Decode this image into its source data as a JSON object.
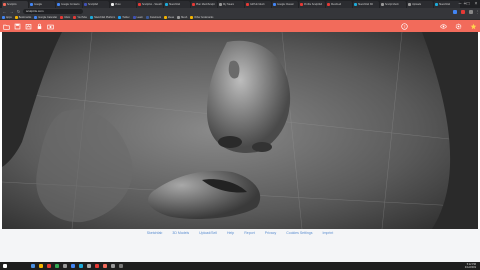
{
  "tabs": [
    {
      "label": "Sculptris",
      "active": true,
      "color": "#f26b5b"
    },
    {
      "label": "Google",
      "active": false,
      "color": "#4285f4"
    },
    {
      "label": "Google Contacts",
      "active": false,
      "color": "#4285f4"
    },
    {
      "label": "Sculptfab",
      "active": false,
      "color": "#3f51b5"
    },
    {
      "label": "Pluto",
      "active": false,
      "color": "#eeeeee"
    },
    {
      "label": "SculptGL - Sketchfab",
      "active": false,
      "color": "#e53935"
    },
    {
      "label": "Sketchfab",
      "active": false,
      "color": "#1caad9"
    },
    {
      "label": "Plan MeshSculpt",
      "active": false,
      "color": "#e53935"
    },
    {
      "label": "My Steam",
      "active": false,
      "color": "#999999"
    },
    {
      "label": "GitHub Mesh",
      "active": false,
      "color": "#e53935"
    },
    {
      "label": "Google Classic",
      "active": false,
      "color": "#4285f4"
    },
    {
      "label": "Profile Sculptfab",
      "active": false,
      "color": "#e53935"
    },
    {
      "label": "MeshLab",
      "active": false,
      "color": "#e53935"
    },
    {
      "label": "Sketchfab 3D",
      "active": false,
      "color": "#1caad9"
    },
    {
      "label": "Sculpt Mesh",
      "active": false,
      "color": "#999999"
    },
    {
      "label": "Uploads",
      "active": false,
      "color": "#999999"
    },
    {
      "label": "Sketchfab",
      "active": false,
      "color": "#1caad9"
    }
  ],
  "address": {
    "url": "sculptris.com"
  },
  "bookmarks": [
    {
      "label": "Apps",
      "color": "#4285f4"
    },
    {
      "label": "Bookmarks",
      "color": "#f4b400"
    },
    {
      "label": "Google Calendar",
      "color": "#4285f4"
    },
    {
      "label": "Inbox",
      "color": "#e53935"
    },
    {
      "label": "YouTube",
      "color": "#e53935"
    },
    {
      "label": "Sketchfab Platform",
      "color": "#1caad9"
    },
    {
      "label": "Twitter",
      "color": "#1da1f2"
    },
    {
      "label": "Learn",
      "color": "#3f51b5"
    },
    {
      "label": "Facebook",
      "color": "#3b5998"
    },
    {
      "label": "Ideas",
      "color": "#f4b400"
    },
    {
      "label": "Mesh",
      "color": "#999999"
    },
    {
      "label": "Other bookmarks",
      "color": "#f4b400"
    }
  ],
  "toolbar": {
    "accent": "#f26b5b",
    "left_icons": [
      "folder-icon",
      "save-icon",
      "export-icon",
      "lock-icon",
      "camera-icon"
    ],
    "right_icons": [
      "help-icon",
      "eye-icon",
      "gear-icon",
      "star-icon"
    ]
  },
  "footer": {
    "links": [
      "Sketchfab",
      "3D Models",
      "Upload/Sell",
      "Help",
      "Report",
      "Privacy",
      "Cookies Settings",
      "Imprint"
    ]
  },
  "taskbar": {
    "time": "5:12 PM",
    "date": "4/12/2019",
    "apps": [
      "#4a90e2",
      "#f4b400",
      "#e53935",
      "#34a853",
      "#999999",
      "#4285f4",
      "#1caad9",
      "#aaaaaa",
      "#e53935",
      "#f26b5b",
      "#999999",
      "#777777"
    ]
  }
}
